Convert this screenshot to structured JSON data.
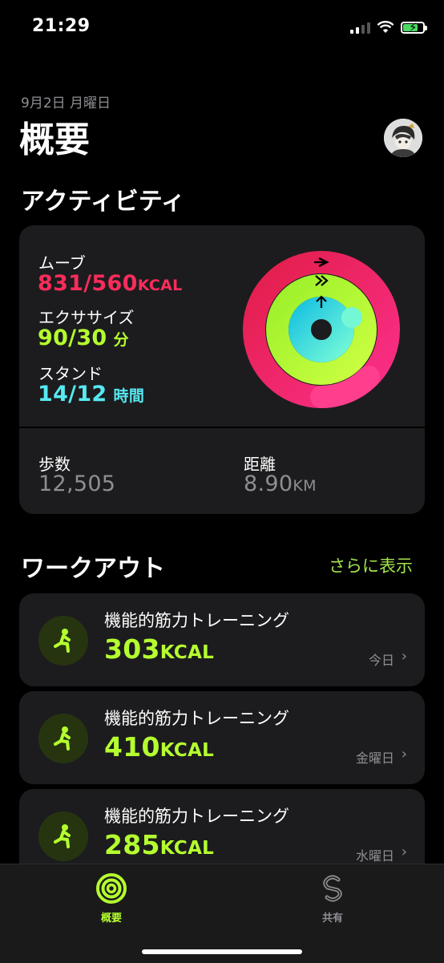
{
  "status": {
    "time": "21:29"
  },
  "header": {
    "date": "9月2日 月曜日",
    "title": "概要"
  },
  "activity": {
    "section_title": "アクティビティ",
    "move": {
      "label": "ムーブ",
      "value": "831/560",
      "unit": "KCAL",
      "color": "#fa2c5b"
    },
    "exercise": {
      "label": "エクササイズ",
      "value": "90/30",
      "unit": "分",
      "color": "#b5ff2f"
    },
    "stand": {
      "label": "スタンド",
      "value": "14/12",
      "unit": "時間",
      "color": "#57e9f2"
    },
    "steps": {
      "label": "歩数",
      "value": "12,505"
    },
    "distance": {
      "label": "距離",
      "value": "8.90",
      "unit": "KM"
    }
  },
  "workouts": {
    "section_title": "ワークアウト",
    "more_link": "さらに表示",
    "items": [
      {
        "name": "機能的筋力トレーニング",
        "value": "303",
        "unit": "KCAL",
        "day": "今日"
      },
      {
        "name": "機能的筋力トレーニング",
        "value": "410",
        "unit": "KCAL",
        "day": "金曜日"
      },
      {
        "name": "機能的筋力トレーニング",
        "value": "285",
        "unit": "KCAL",
        "day": "水曜日"
      }
    ]
  },
  "tabbar": {
    "tabs": [
      {
        "label": "概要",
        "icon": "activity-rings-icon",
        "active": true
      },
      {
        "label": "共有",
        "icon": "sharing-icon",
        "active": false
      }
    ]
  }
}
